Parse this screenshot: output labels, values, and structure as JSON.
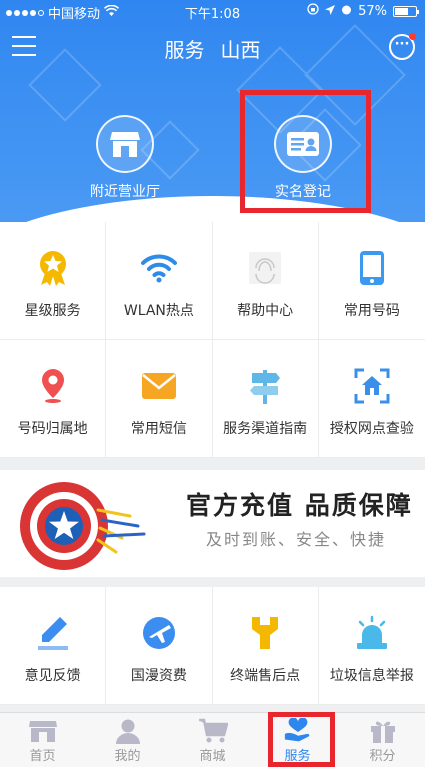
{
  "status": {
    "carrier": "中国移动",
    "time": "下午1:08",
    "battery": "57%"
  },
  "nav": {
    "title": "服务",
    "city": "山西"
  },
  "hero": [
    {
      "label": "附近营业厅",
      "icon": "store-icon"
    },
    {
      "label": "实名登记",
      "icon": "id-card-icon"
    }
  ],
  "grid1": [
    {
      "label": "星级服务",
      "icon": "star-medal-icon",
      "color": "#f5b800"
    },
    {
      "label": "WLAN热点",
      "icon": "wifi-icon",
      "color": "#2e8be8"
    },
    {
      "label": "帮助中心",
      "icon": "help-center-icon",
      "color": "#bdbdbd"
    },
    {
      "label": "常用号码",
      "icon": "phone-icon",
      "color": "#3b9af0"
    },
    {
      "label": "号码归属地",
      "icon": "location-pin-icon",
      "color": "#f05050"
    },
    {
      "label": "常用短信",
      "icon": "envelope-icon",
      "color": "#f6a623"
    },
    {
      "label": "服务渠道指南",
      "icon": "signpost-icon",
      "color": "#5fb7e8"
    },
    {
      "label": "授权网点查验",
      "icon": "home-scan-icon",
      "color": "#3a8fe8"
    }
  ],
  "banner": {
    "title": "官方充值 品质保障",
    "subtitle": "及时到账、安全、快捷"
  },
  "grid2": [
    {
      "label": "意见反馈",
      "icon": "pencil-icon",
      "color": "#3b8ef0"
    },
    {
      "label": "国漫资费",
      "icon": "plane-globe-icon",
      "color": "#3b8ef0"
    },
    {
      "label": "终端售后点",
      "icon": "wrench-icon",
      "color": "#f5b800"
    },
    {
      "label": "垃圾信息举报",
      "icon": "alarm-icon",
      "color": "#4ab8e8"
    }
  ],
  "tabs": [
    {
      "label": "首页",
      "icon": "home-icon",
      "active": false
    },
    {
      "label": "我的",
      "icon": "user-icon",
      "active": false
    },
    {
      "label": "商城",
      "icon": "cart-icon",
      "active": false
    },
    {
      "label": "服务",
      "icon": "heart-hand-icon",
      "active": true
    },
    {
      "label": "积分",
      "icon": "gift-icon",
      "active": false
    }
  ],
  "colors": {
    "primary": "#2e86ef",
    "highlight": "#e8262e"
  }
}
